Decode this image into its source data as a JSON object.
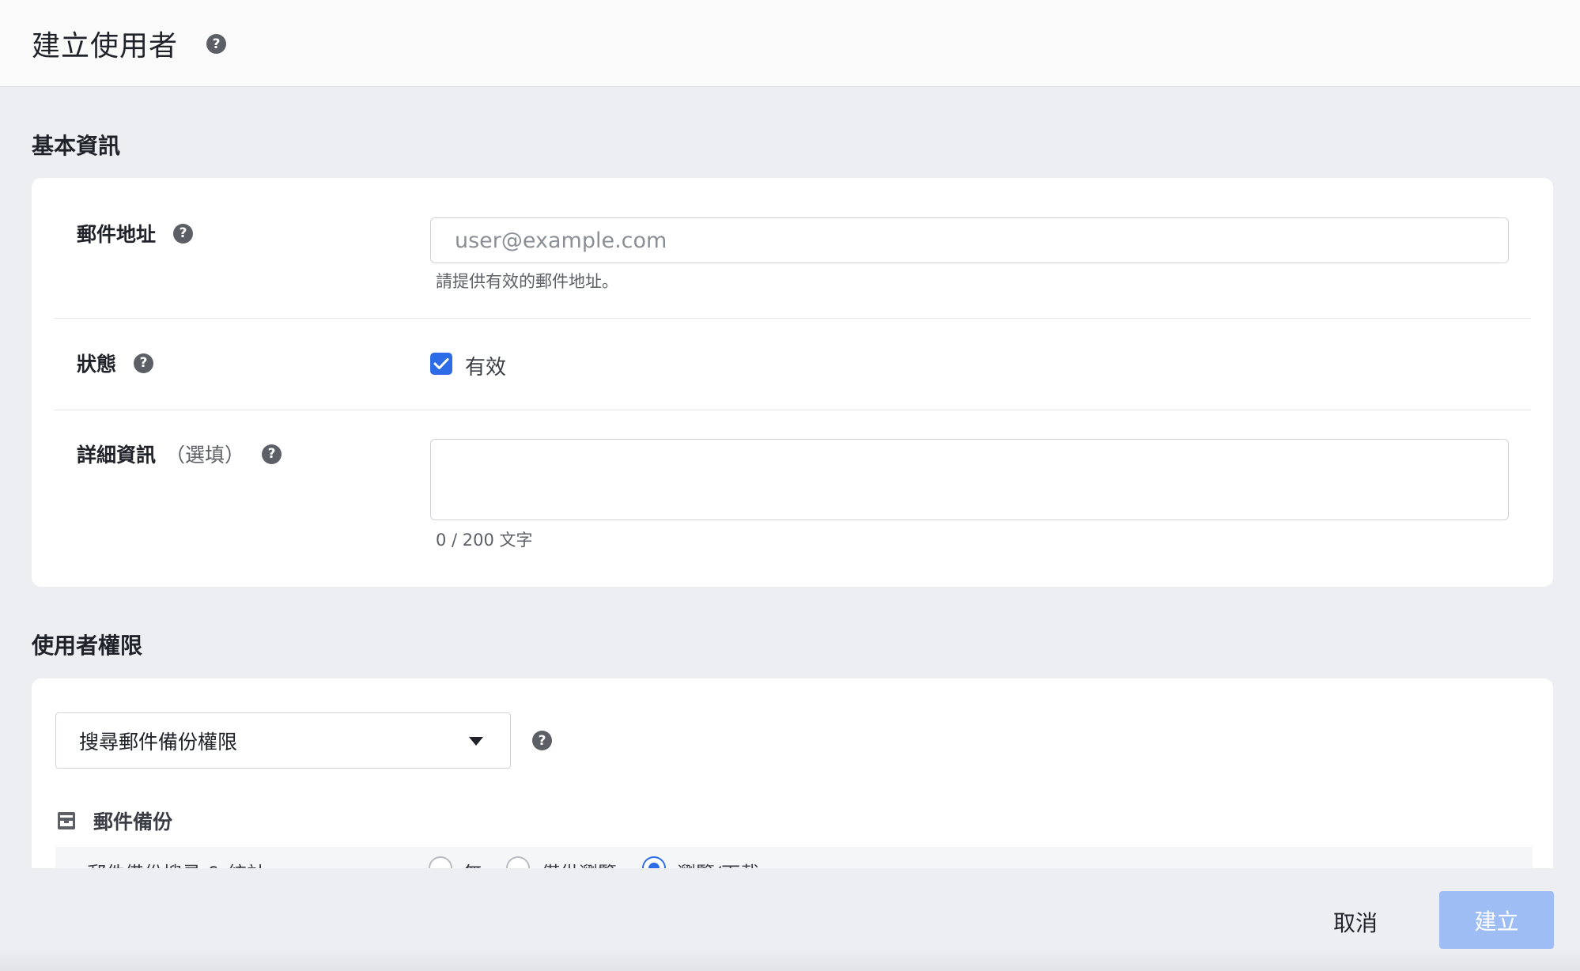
{
  "header": {
    "title": "建立使用者",
    "help_glyph": "?"
  },
  "basic": {
    "section_title": "基本資訊",
    "email": {
      "label": "郵件地址",
      "placeholder": "user@example.com",
      "hint": "請提供有效的郵件地址。"
    },
    "status": {
      "label": "狀態",
      "checkbox_label": "有效",
      "checked": true
    },
    "details": {
      "label": "詳細資訊",
      "optional": "（選填）",
      "value": "",
      "counter": "0 / 200 文字"
    }
  },
  "permissions": {
    "section_title": "使用者權限",
    "select_value": "搜尋郵件備份權限",
    "subsection": "郵件備份",
    "row": {
      "label": "郵件備份搜尋 & 統計",
      "options": [
        "無",
        "僅供瀏覽",
        "瀏覽/下載"
      ],
      "selected": "瀏覽/下載"
    }
  },
  "footer": {
    "cancel_label": "取消",
    "create_label": "建立"
  },
  "colors": {
    "accent": "#2e6be6",
    "create_disabled": "#9dbdf4",
    "background": "#edeef1"
  }
}
